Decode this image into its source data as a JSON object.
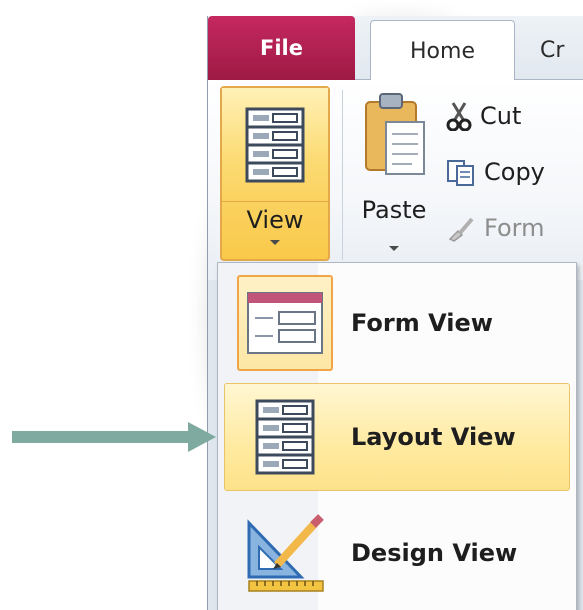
{
  "ribbon": {
    "tabs": {
      "file": "File",
      "home": "Home",
      "create": "Cr"
    },
    "view_button": {
      "label": "View",
      "icon": "layout-view-icon"
    },
    "paste_button": {
      "label": "Paste",
      "icon": "clipboard-paste-icon"
    },
    "clipboard": {
      "cut": "Cut",
      "copy": "Copy",
      "format_painter": "Form"
    }
  },
  "view_menu": {
    "items": [
      {
        "label": "Form View",
        "icon": "form-view-icon"
      },
      {
        "label": "Layout View",
        "icon": "layout-view-icon",
        "highlighted": true
      },
      {
        "label": "Design View",
        "icon": "design-view-icon"
      }
    ]
  },
  "colors": {
    "file_tab": "#b31f52",
    "highlight": "#fde28a",
    "arrow": "#7faaa0"
  }
}
